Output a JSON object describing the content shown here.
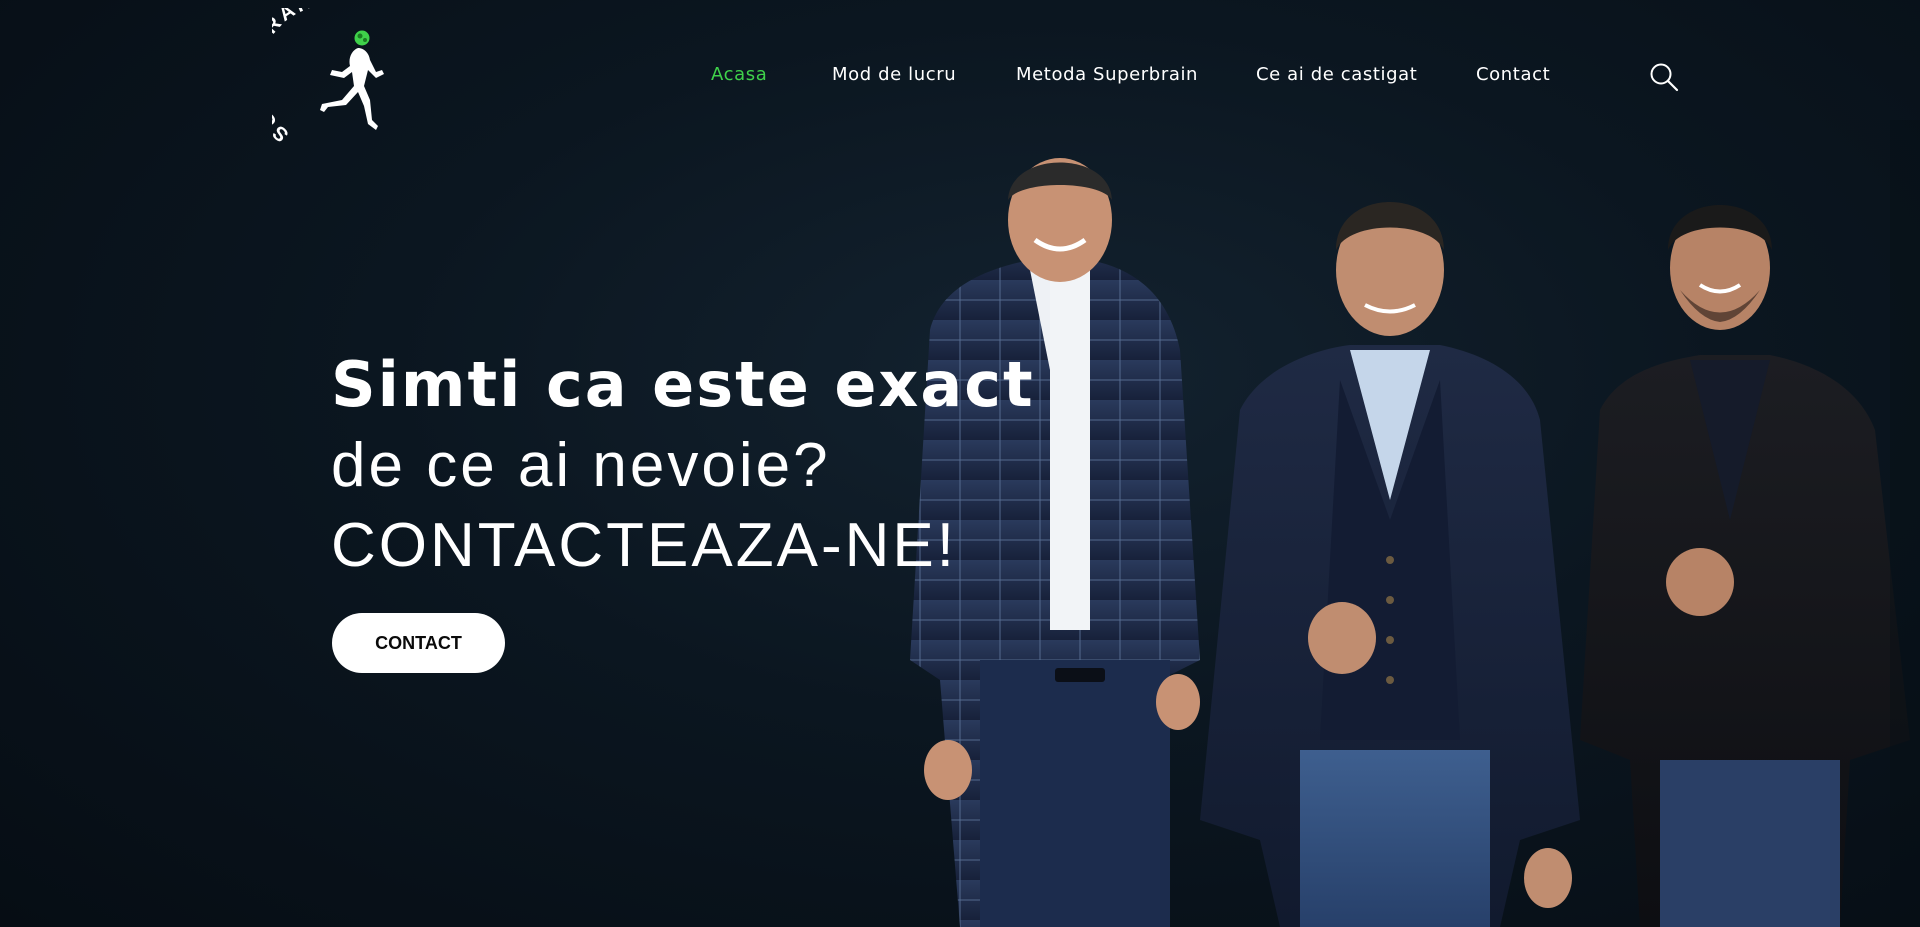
{
  "brand": {
    "logo_text": "SUPER BRAIN",
    "logo_icon": "running-man-brain-icon",
    "accent_color": "#3fd14a"
  },
  "nav": {
    "items": [
      {
        "label": "Acasa",
        "active": true
      },
      {
        "label": "Mod de lucru",
        "active": false
      },
      {
        "label": "Metoda Superbrain",
        "active": false
      },
      {
        "label": "Ce ai de castigat",
        "active": false
      },
      {
        "label": "Contact",
        "active": false
      }
    ],
    "search_icon": "search-icon"
  },
  "hero": {
    "line1": "Simti ca este exact",
    "line2": "de ce ai nevoie?",
    "line3": "CONTACTEAZA-NE!",
    "cta_label": "CONTACT"
  },
  "colors": {
    "background": "#0b1620",
    "text": "#ffffff",
    "active_nav": "#3fd14a",
    "button_bg": "#ffffff",
    "button_text": "#0a0a0a"
  }
}
